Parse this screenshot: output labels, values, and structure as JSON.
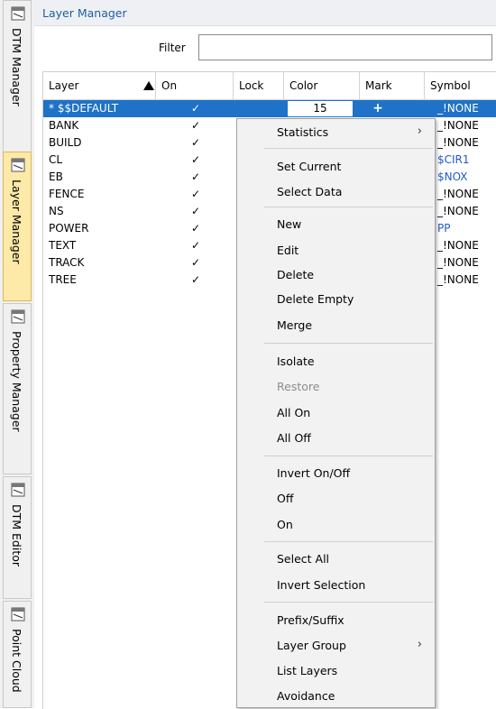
{
  "side_tabs": [
    {
      "label": "DTM Manager",
      "active": false
    },
    {
      "label": "Layer Manager",
      "active": true
    },
    {
      "label": "Property Manager",
      "active": false
    },
    {
      "label": "DTM Editor",
      "active": false
    },
    {
      "label": "Point Cloud",
      "active": false
    }
  ],
  "panel": {
    "title": "Layer Manager",
    "filter_label": "Filter",
    "filter_value": ""
  },
  "grid": {
    "columns": [
      "Layer",
      "On",
      "Lock",
      "Color",
      "Mark",
      "Symbol"
    ],
    "sort_column": "Layer",
    "rows": [
      {
        "layer": "* $$DEFAULT",
        "on": "✓",
        "color": "15",
        "mark": "+",
        "symbol": "_!NONE",
        "selected": true
      },
      {
        "layer": "BANK",
        "on": "✓",
        "color": "",
        "mark": "",
        "symbol": "_!NONE"
      },
      {
        "layer": "BUILD",
        "on": "✓",
        "color": "",
        "mark": "",
        "symbol": "_!NONE"
      },
      {
        "layer": "CL",
        "on": "✓",
        "color": "",
        "mark": "",
        "symbol": "$CIR1"
      },
      {
        "layer": "EB",
        "on": "✓",
        "color": "",
        "mark": "",
        "symbol": "$NOX"
      },
      {
        "layer": "FENCE",
        "on": "✓",
        "color": "",
        "mark": "",
        "symbol": "_!NONE"
      },
      {
        "layer": "NS",
        "on": "✓",
        "color": "",
        "mark": "",
        "symbol": "_!NONE"
      },
      {
        "layer": "POWER",
        "on": "✓",
        "color": "",
        "mark": "",
        "symbol": "PP"
      },
      {
        "layer": "TEXT",
        "on": "✓",
        "color": "",
        "mark": "",
        "symbol": "_!NONE"
      },
      {
        "layer": "TRACK",
        "on": "✓",
        "color": "",
        "mark": "",
        "symbol": "_!NONE"
      },
      {
        "layer": "TREE",
        "on": "✓",
        "color": "",
        "mark": "",
        "symbol": "_!NONE"
      }
    ]
  },
  "context_menu": {
    "items": [
      {
        "label": "Statistics",
        "submenu": true
      },
      {
        "label": "Set Current"
      },
      {
        "label": "Select Data"
      },
      {
        "label": "New"
      },
      {
        "label": "Edit"
      },
      {
        "label": "Delete"
      },
      {
        "label": "Delete Empty"
      },
      {
        "label": "Merge"
      },
      {
        "label": "Isolate"
      },
      {
        "label": "Restore",
        "disabled": true
      },
      {
        "label": "All On"
      },
      {
        "label": "All Off"
      },
      {
        "label": "Invert On/Off"
      },
      {
        "label": "Off"
      },
      {
        "label": "On"
      },
      {
        "label": "Select All"
      },
      {
        "label": "Invert Selection"
      },
      {
        "label": "Prefix/Suffix"
      },
      {
        "label": "Layer Group",
        "submenu": true
      },
      {
        "label": "List Layers"
      },
      {
        "label": "Avoidance"
      }
    ]
  },
  "colors": {
    "selection": "#1e72c8",
    "title_text": "#1f5e9e",
    "symbol_link": "#1f5cc2",
    "active_tab": "#fde9a8"
  }
}
